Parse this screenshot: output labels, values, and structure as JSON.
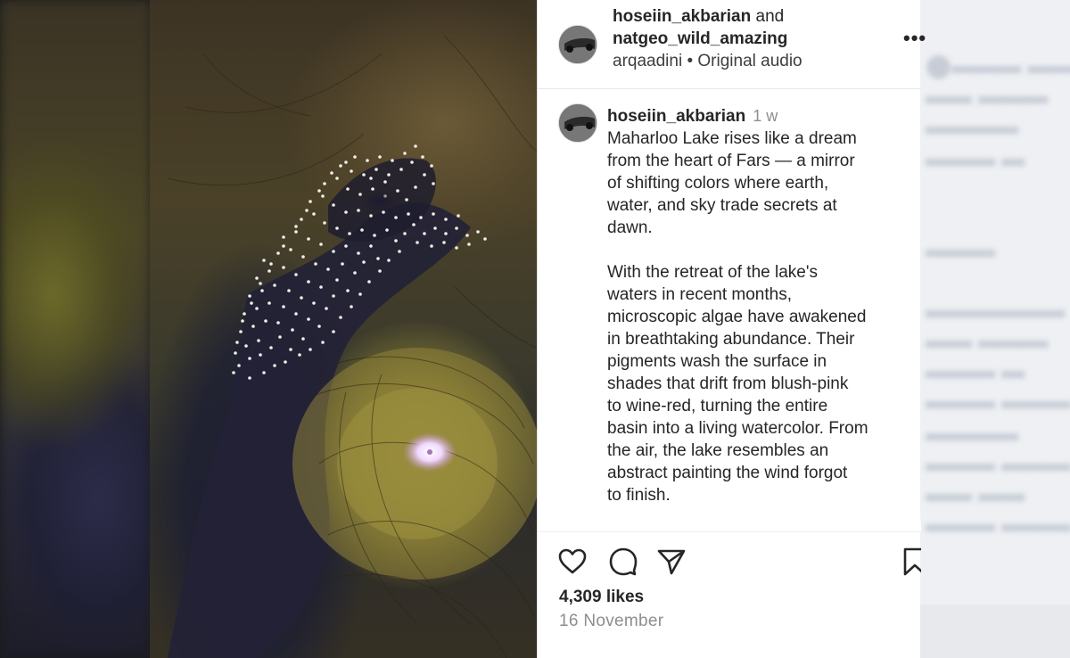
{
  "post": {
    "author": "hoseiin_akbarian",
    "and_text": "and",
    "collaborator": "natgeo_wild_amazing",
    "audio_line": "arqaadini • Original audio",
    "more_label": "•••"
  },
  "caption": {
    "user": "hoseiin_akbarian",
    "time": "1 w",
    "paragraph_1": "Maharloo Lake rises like a dream\nfrom the heart of Fars — a mirror\nof shifting colors where earth,\nwater, and sky trade secrets at\ndawn.",
    "paragraph_2": "With the retreat of the lake's\nwaters in recent months,\nmicroscopic algae have awakened\nin breathtaking abundance. Their\npigments wash the surface in\nshades that drift from blush-pink\nto wine-red, turning the entire\nbasin into a living watercolor. From\nthe air, the lake resembles an\nabstract painting the wind forgot\nto finish."
  },
  "engagement": {
    "likes": "4,309 likes",
    "date": "16 November"
  },
  "icons": [
    "heart-icon",
    "comment-icon",
    "share-icon",
    "bookmark-icon",
    "more-icon"
  ],
  "colors": {
    "text": "#262626",
    "secondary_text": "#8e8e8e",
    "panel_bg": "#ffffff"
  }
}
